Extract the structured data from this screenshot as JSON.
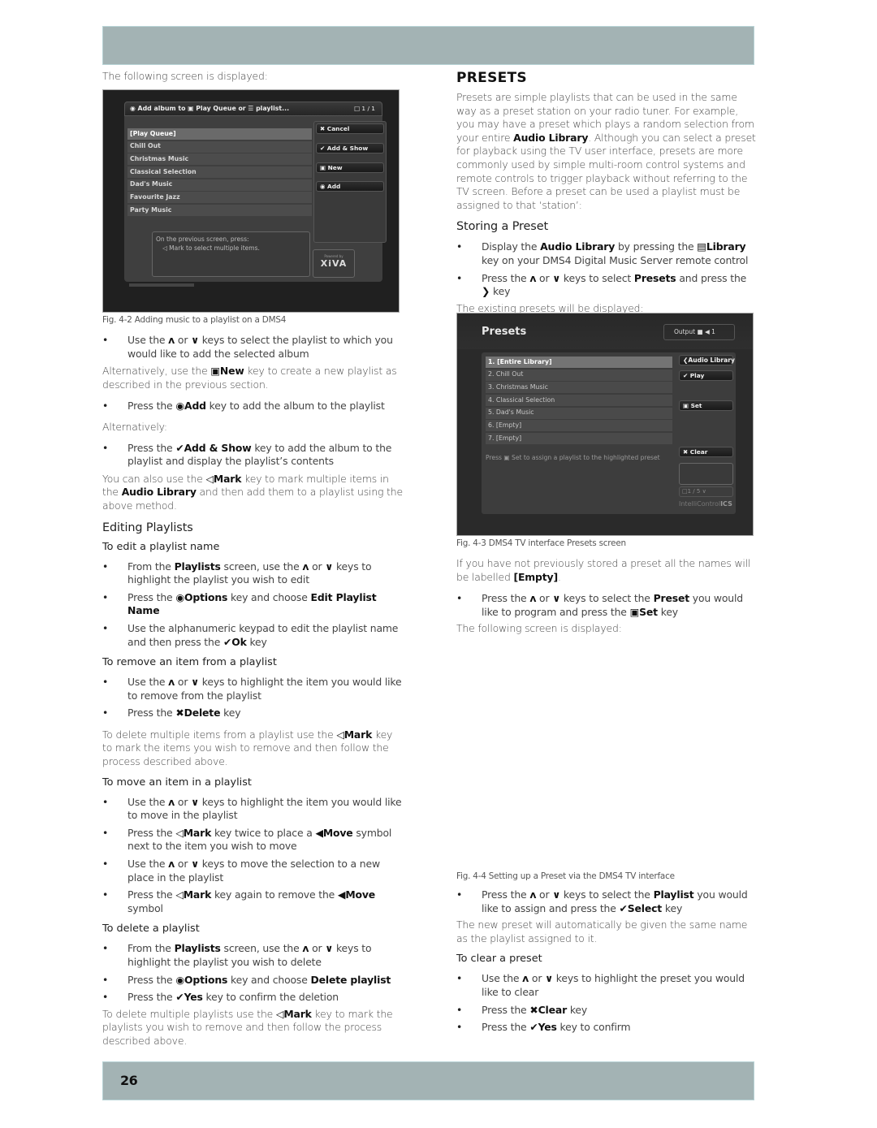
{
  "page_number": "26",
  "left": {
    "intro": "The following screen is displayed:",
    "fig1": {
      "header": "Add album to ▣ Play Queue or ☰ playlist...",
      "page_indicator": "1 / 1",
      "items": [
        "[Play Queue]",
        "Chill Out",
        "Christmas Music",
        "Classical Selection",
        "Dad's Music",
        "Favourite Jazz",
        "Party Music"
      ],
      "buttons": {
        "cancel": "Cancel",
        "add_show": "Add & Show",
        "new": "New",
        "add": "Add"
      },
      "note_line1": "On the previous screen, press:",
      "note_line2": "◁ Mark to select multiple items.",
      "logo_small": "Powered by",
      "logo": "XiVA"
    },
    "fig1_caption": "Fig. 4-2  Adding music to a playlist on a DMS4",
    "b1_a": "Use the ",
    "b1_b": " keys to select the playlist to which you would like to add the selected album",
    "alt1_a": "Alternatively, use the ",
    "alt1_key": "New",
    "alt1_b": " key to create a new playlist as described in the previous section.",
    "b2_a": "Press the ",
    "b2_key": "Add",
    "b2_b": " key to add the album to the playlist",
    "alt2": "Alternatively:",
    "b3_a": "Press the ",
    "b3_key": "Add & Show",
    "b3_b": " key to add the album to the playlist and display the playlist’s contents",
    "mark_a": "You can also use the ",
    "mark_key": "Mark",
    "mark_b": " key to mark multiple items in the ",
    "mark_lib": "Audio Library",
    "mark_c": " and then add them to a playlist using the above method.",
    "editing_heading": "Editing Playlists",
    "edit_name": {
      "heading": "To edit a playlist name",
      "b1_a": "From the ",
      "b1_k": "Playlists",
      "b1_b": " screen, use the ",
      "b1_c": " keys to highlight the playlist you wish to edit",
      "b2_a": "Press the ",
      "b2_k": "Options",
      "b2_b": " key and choose ",
      "b2_k2": "Edit Playlist Name",
      "b3_a": "Use the alphanumeric keypad to edit the playlist name and then press the ",
      "b3_k": "Ok",
      "b3_b": " key"
    },
    "remove_item": {
      "heading": "To remove an item from a playlist",
      "b1_a": "Use the ",
      "b1_b": " keys to highlight the item you would like to remove from the playlist",
      "b2_a": "Press the ",
      "b2_k": "Delete",
      "b2_b": " key",
      "multi_a": "To delete multiple items from a playlist use the ",
      "multi_k": "Mark",
      "multi_b": " key to mark the items you wish to remove and then follow the process described above."
    },
    "move_item": {
      "heading": "To move an item in a playlist",
      "b1_a": "Use the ",
      "b1_b": " keys to highlight the item you would like to move in the playlist",
      "b2_a": "Press the ",
      "b2_k": "Mark",
      "b2_b": " key twice to place a ",
      "b2_k2": "Move",
      "b2_c": " symbol next to the item you wish to move",
      "b3_a": "Use the ",
      "b3_b": " keys to move the selection to a new place in the playlist",
      "b4_a": "Press the ",
      "b4_k": "Mark",
      "b4_b": " key again to remove the ",
      "b4_k2": "Move",
      "b4_c": " symbol"
    },
    "delete_playlist": {
      "heading": "To delete a playlist",
      "b1_a": "From the ",
      "b1_k": "Playlists",
      "b1_b": " screen, use the ",
      "b1_c": " keys to highlight the playlist you wish to delete",
      "b2_a": "Press the ",
      "b2_k": "Options",
      "b2_b": " key and choose ",
      "b2_k2": "Delete playlist",
      "b3_a": "Press the ",
      "b3_k": "Yes",
      "b3_b": " key to confirm the deletion",
      "multi_a": "To delete multiple playlists use the ",
      "multi_k": "Mark",
      "multi_b": " key to mark the playlists you wish to remove and then follow the process described above."
    }
  },
  "right": {
    "title": "PRESETS",
    "intro_a": "Presets are simple playlists that can be used in the same way as a preset station on your radio tuner. For example, you may have a preset which plays a random selection from your entire ",
    "intro_k": "Audio Library",
    "intro_b": ".  Although you can select a preset for playback using the TV user interface, presets are more commonly used by simple multi-room control systems and remote controls to trigger playback without  referring to the TV screen. Before a preset can be used a playlist must be assigned to that ‘station’:",
    "storing_heading": "Storing a Preset",
    "s_b1_a": "Display the ",
    "s_b1_k": "Audio Library",
    "s_b1_b": " by pressing the ",
    "s_b1_k2": "Library",
    "s_b1_c": " key on your DMS4 Digital Music Server remote control",
    "s_b2_a": "Press the ",
    "s_b2_b": " keys to select ",
    "s_b2_k": "Presets",
    "s_b2_c": " and press the ",
    "s_b2_d": " key",
    "existing": "The existing presets will be displayed:",
    "fig2": {
      "title": "Presets",
      "output_label": "Output",
      "output_zone": "1",
      "items": [
        "1. [Entire Library]",
        "2. Chill Out",
        "3. Christmas Music",
        "4. Classical Selection",
        "5. Dad's Music",
        "6. [Empty]",
        "7. [Empty]"
      ],
      "buttons": {
        "audio_library": "Audio Library",
        "play": "Play",
        "set": "Set",
        "clear": "Clear"
      },
      "hint_a": "Press ",
      "hint_b": " Set to assign a playlist to the highlighted preset",
      "pager": "1 / 5",
      "brand_a": "IntelliControl",
      "brand_b": "ICS"
    },
    "fig2_caption": "Fig. 4-3  DMS4 TV interface Presets screen",
    "empty_a": "If you have not previously stored a preset all the names will be labelled ",
    "empty_k": "[Empty]",
    "empty_b": ".",
    "p_b1_a": "Press the ",
    "p_b1_b": " keys to select the ",
    "p_b1_k": "Preset",
    "p_b1_c": " you would like to program and press the ",
    "p_b1_k2": "Set",
    "p_b1_d": " key",
    "following": "The following screen is displayed:",
    "fig3_caption": "Fig. 4-4  Setting up a Preset via the DMS4 TV interface",
    "a_b1_a": "Press the ",
    "a_b1_b": " keys to select the ",
    "a_b1_k": "Playlist",
    "a_b1_c": " you would like to assign and press the ",
    "a_b1_k2": "Select",
    "a_b1_d": " key",
    "new_preset": "The new preset will automatically be given the same name as the playlist assigned to it.",
    "clear_heading": "To clear a preset",
    "c_b1_a": "Use the ",
    "c_b1_b": " keys to highlight the preset you would like to clear",
    "c_b2_a": "Press the ",
    "c_b2_k": "Clear",
    "c_b2_b": " key",
    "c_b3_a": "Press the ",
    "c_b3_k": "Yes",
    "c_b3_b": " key to confirm"
  },
  "glyphs": {
    "up": "ʌ",
    "down": "∨",
    "or": " or ",
    "new_icon": "▣",
    "add_icon": "◉",
    "check": "✔",
    "mark": "◁",
    "cross": "✖",
    "move": "◀",
    "library": "▤",
    "right": "❯"
  }
}
